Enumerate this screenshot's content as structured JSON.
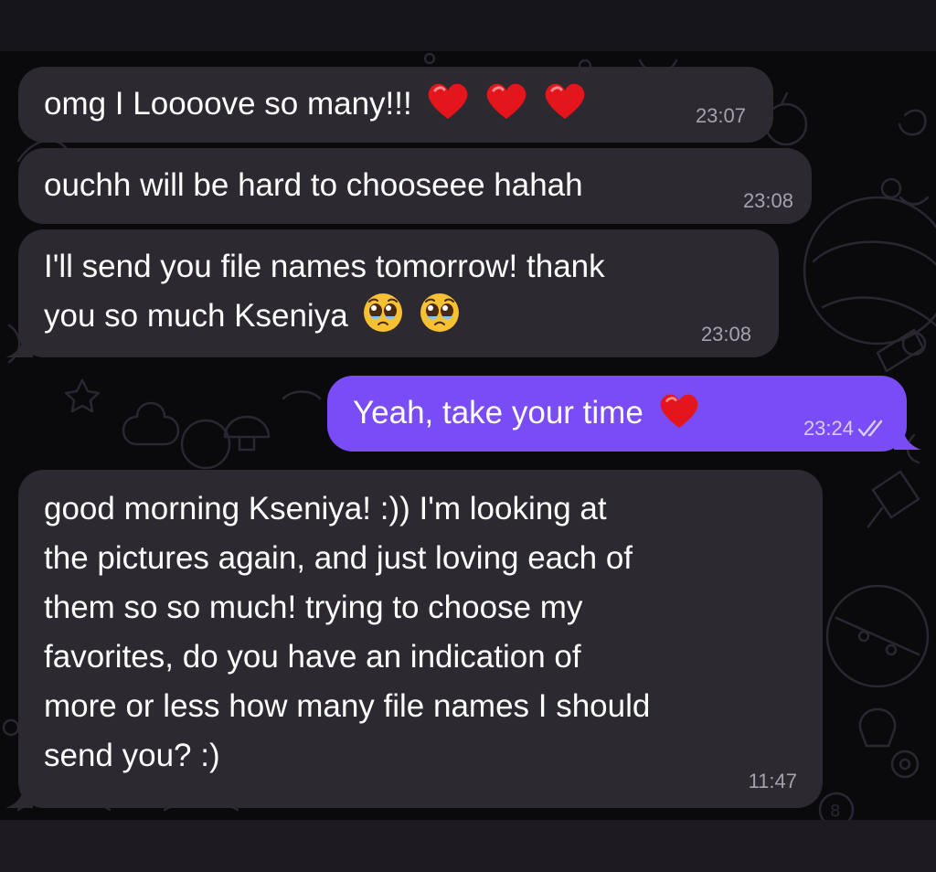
{
  "messages": [
    {
      "id": 1,
      "direction": "incoming",
      "text": "omg I Loooove so many!!!",
      "emoji": [
        "red-heart",
        "red-heart",
        "red-heart"
      ],
      "time": "23:07"
    },
    {
      "id": 2,
      "direction": "incoming",
      "text": "ouchh will be hard to chooseee hahah",
      "time": "23:08"
    },
    {
      "id": 3,
      "direction": "incoming",
      "text_line1": "I'll send you file names tomorrow! thank",
      "text_line2": "you so much Kseniya",
      "emoji": [
        "pleading-face",
        "pleading-face"
      ],
      "time": "23:08"
    },
    {
      "id": 4,
      "direction": "outgoing",
      "text": "Yeah, take your time",
      "emoji": [
        "red-heart"
      ],
      "time": "23:24",
      "status": "read"
    },
    {
      "id": 5,
      "direction": "incoming",
      "lines": [
        "good morning Kseniya! :)) I'm looking at",
        "the pictures again, and just loving each of",
        "them so so much! trying to choose my",
        "favorites, do you have an indication of",
        "more or less how many file names I should",
        "send you? :)"
      ],
      "time": "11:47"
    }
  ],
  "colors": {
    "incoming_bubble": "#2c2930",
    "outgoing_bubble": "#7a4cf6",
    "background": "#0a090c",
    "text": "#ffffff",
    "timestamp": "#a6a2ab"
  }
}
